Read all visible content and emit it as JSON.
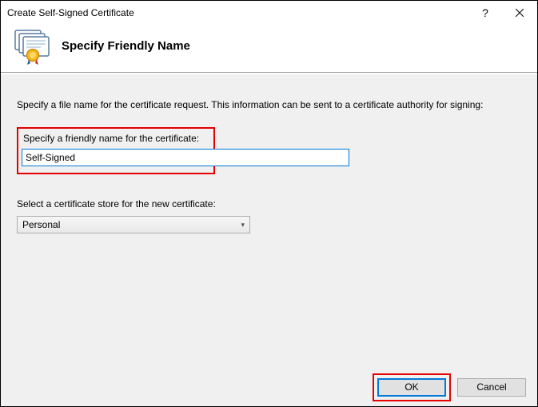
{
  "window": {
    "title": "Create Self-Signed Certificate"
  },
  "header": {
    "title": "Specify Friendly Name"
  },
  "content": {
    "intro": "Specify a file name for the certificate request.  This information can be sent to a certificate authority for signing:",
    "friendly_name_label": "Specify a friendly name for the certificate:",
    "friendly_name_value": "Self-Signed",
    "store_label": "Select a certificate store for the new certificate:",
    "store_value": "Personal"
  },
  "footer": {
    "ok": "OK",
    "cancel": "Cancel"
  }
}
